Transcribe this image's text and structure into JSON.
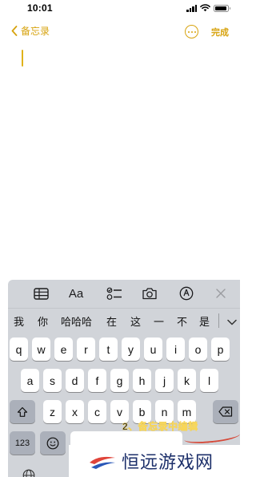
{
  "status_bar": {
    "time": "10:01",
    "battery_level": 0.9
  },
  "nav": {
    "back_label": "备忘录",
    "done_label": "完成"
  },
  "toolbar": {
    "format_label": "Aa"
  },
  "candidates": [
    "我",
    "你",
    "哈哈哈",
    "在",
    "这",
    "一",
    "不",
    "是"
  ],
  "keyboard": {
    "row1": [
      "q",
      "w",
      "e",
      "r",
      "t",
      "y",
      "u",
      "i",
      "o",
      "p"
    ],
    "row2": [
      "a",
      "s",
      "d",
      "f",
      "g",
      "h",
      "j",
      "k",
      "l"
    ],
    "row3": [
      "z",
      "x",
      "c",
      "v",
      "b",
      "n",
      "m"
    ],
    "numbers_label": "123"
  },
  "overlay": {
    "caption": "2、备忘录中编辑",
    "brand": "恒远游戏网"
  },
  "colors": {
    "accent": "#d7a30f",
    "keyboard_bg": "#d1d4d9",
    "function_key": "#abb0ba"
  }
}
